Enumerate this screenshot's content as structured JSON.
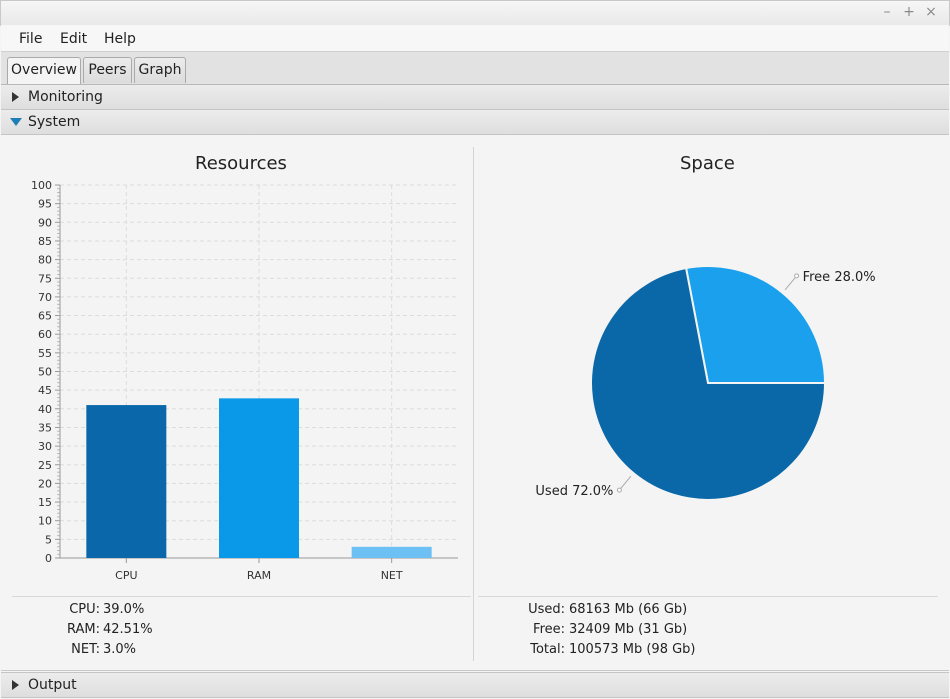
{
  "window": {
    "minimize_glyph": "–",
    "maximize_glyph": "+",
    "close_glyph": "×"
  },
  "menu": {
    "items": [
      "File",
      "Edit",
      "Help"
    ]
  },
  "tabs": [
    {
      "label": "Overview",
      "active": true
    },
    {
      "label": "Peers",
      "active": false
    },
    {
      "label": "Graph",
      "active": false
    }
  ],
  "sections": {
    "monitoring": {
      "label": "Monitoring",
      "expanded": false
    },
    "system": {
      "label": "System",
      "expanded": true
    },
    "output": {
      "label": "Output",
      "expanded": false
    }
  },
  "resources": {
    "stats": [
      {
        "label": "CPU:",
        "value": "39.0%"
      },
      {
        "label": "RAM:",
        "value": "42.51%"
      },
      {
        "label": "NET:",
        "value": "3.0%"
      }
    ]
  },
  "space": {
    "stats": [
      {
        "label": "Used:",
        "value": "68163 Mb (66 Gb)"
      },
      {
        "label": "Free:",
        "value": "32409 Mb (31 Gb)"
      },
      {
        "label": "Total:",
        "value": "100573 Mb (98 Gb)"
      }
    ]
  },
  "colors": {
    "cpu_bar": "#0a68aa",
    "ram_bar": "#0a98e8",
    "net_bar": "#6cc0f4",
    "pie_used": "#0a68a8",
    "pie_free": "#1aa0ec"
  },
  "chart_data": [
    {
      "type": "bar",
      "title": "Resources",
      "categories": [
        "CPU",
        "RAM",
        "NET"
      ],
      "values": [
        41,
        42.8,
        3
      ],
      "ylim": [
        0,
        100
      ],
      "ytick_step": 5,
      "grid": true,
      "legend": "none"
    },
    {
      "type": "pie",
      "title": "Space",
      "slices": [
        {
          "label": "Free 28.0%",
          "value": 28.0
        },
        {
          "label": "Used 72.0%",
          "value": 72.0
        }
      ],
      "legend": "none"
    }
  ]
}
